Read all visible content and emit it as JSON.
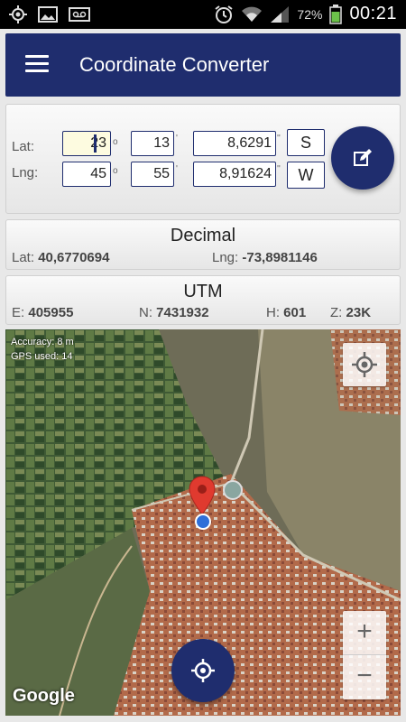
{
  "status_bar": {
    "battery_percent": "72%",
    "time": "00:21",
    "icons": [
      "gps-icon",
      "image-icon",
      "voicemail-icon",
      "alarm-icon",
      "wifi-icon",
      "signal-icon",
      "battery-icon"
    ]
  },
  "app_bar": {
    "title": "Coordinate Converter",
    "menu_icon": "hamburger-menu-icon"
  },
  "input": {
    "lat_label": "Lat:",
    "lng_label": "Lng:",
    "lat": {
      "degrees": "23",
      "minutes": "13",
      "seconds": "8,6291",
      "direction": "S"
    },
    "lng": {
      "degrees": "45",
      "minutes": "55",
      "seconds": "8,91624",
      "direction": "W"
    },
    "deg_unit": "o",
    "min_unit": "'",
    "sec_unit": "''"
  },
  "decimal": {
    "title": "Decimal",
    "lat_label": "Lat:",
    "lat_value": "40,6770694",
    "lng_label": "Lng:",
    "lng_value": "-73,8981146"
  },
  "utm": {
    "title": "UTM",
    "e_label": "E:",
    "e_value": "405955",
    "n_label": "N:",
    "n_value": "7431932",
    "h_label": "H:",
    "h_value": "601",
    "z_label": "Z:",
    "z_value": "23K"
  },
  "map": {
    "accuracy": "Accuracy: 8 m",
    "gps_used": "GPS used: 14",
    "zoom_in": "+",
    "zoom_out": "−",
    "logo": "Google"
  },
  "colors": {
    "primary": "#1f2d6e",
    "pin": "#e03a2f",
    "location_dot": "#2f6fd8"
  }
}
